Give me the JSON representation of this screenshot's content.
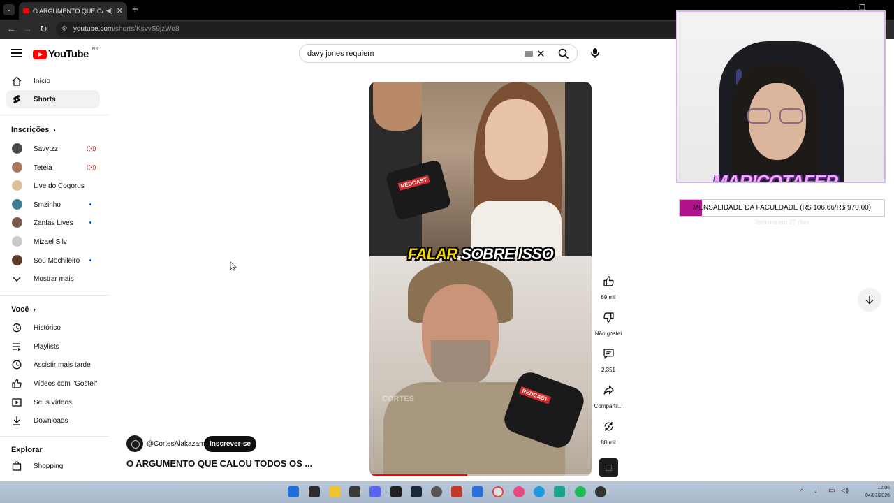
{
  "browser": {
    "tab_title": "O ARGUMENTO QUE CALOU",
    "url_host": "youtube.com",
    "url_path": "/shorts/KsvvS9jzWo8"
  },
  "header": {
    "logo_text": "YouTube",
    "country": "BR",
    "search_value": "davy jones requiem"
  },
  "sidebar": {
    "main": [
      {
        "label": "Início",
        "icon": "home-icon"
      },
      {
        "label": "Shorts",
        "icon": "shorts-icon"
      }
    ],
    "subs_heading": "Inscrições",
    "subscriptions": [
      {
        "label": "Savytzz",
        "status": "live",
        "color": "#4a4a4a"
      },
      {
        "label": "Tetéia",
        "status": "live",
        "color": "#a67a5b"
      },
      {
        "label": "Live do Cogorus",
        "status": "",
        "color": "#d9c09a"
      },
      {
        "label": "Smzinho",
        "status": "new",
        "color": "#3e7e92"
      },
      {
        "label": "Zanfas Lives",
        "status": "new",
        "color": "#7a5b4a"
      },
      {
        "label": "Mizael Silv",
        "status": "",
        "color": "#c9c9c9"
      },
      {
        "label": "Sou Mochileiro",
        "status": "new",
        "color": "#5b3b2b"
      }
    ],
    "show_more": "Mostrar mais",
    "you_heading": "Você",
    "you": [
      {
        "label": "Histórico",
        "icon": "history-icon"
      },
      {
        "label": "Playlists",
        "icon": "playlists-icon"
      },
      {
        "label": "Assistir mais tarde",
        "icon": "watch-later-icon"
      },
      {
        "label": "Vídeos com \"Gostei\"",
        "icon": "liked-icon"
      },
      {
        "label": "Seus vídeos",
        "icon": "your-videos-icon"
      },
      {
        "label": "Downloads",
        "icon": "downloads-icon"
      }
    ],
    "explore_heading": "Explorar",
    "explore": [
      {
        "label": "Shopping",
        "icon": "shopping-icon"
      }
    ]
  },
  "short": {
    "caption_word1": "FALAR",
    "caption_rest": "SOBRE ISSO",
    "mic_brand": "REDCAST",
    "watermark": "CORTES",
    "progress": 0.44,
    "channel": "@CortesAlakazam",
    "subscribe": "Inscrever-se",
    "title": "O ARGUMENTO QUE CALOU TODOS OS ..."
  },
  "actions": {
    "likes": "69 mil",
    "dislike": "Não gostei",
    "comments": "2.351",
    "share": "Compartil...",
    "remix": "88 mil"
  },
  "overlay": {
    "streamer_name": "MARICOTAFER",
    "goal_text": "MENSALIDADE DA FACULDADE (R$ 106,66/R$ 970,00)",
    "goal_progress": 0.11,
    "goal_sub": "Termina em 27 dias"
  },
  "clock": {
    "time": "12:06",
    "date": "04/03/2026"
  },
  "colors": {
    "brand": "#ff0000",
    "goal_fill": "#b0138b",
    "streamer_name": "#f7a8f7"
  }
}
